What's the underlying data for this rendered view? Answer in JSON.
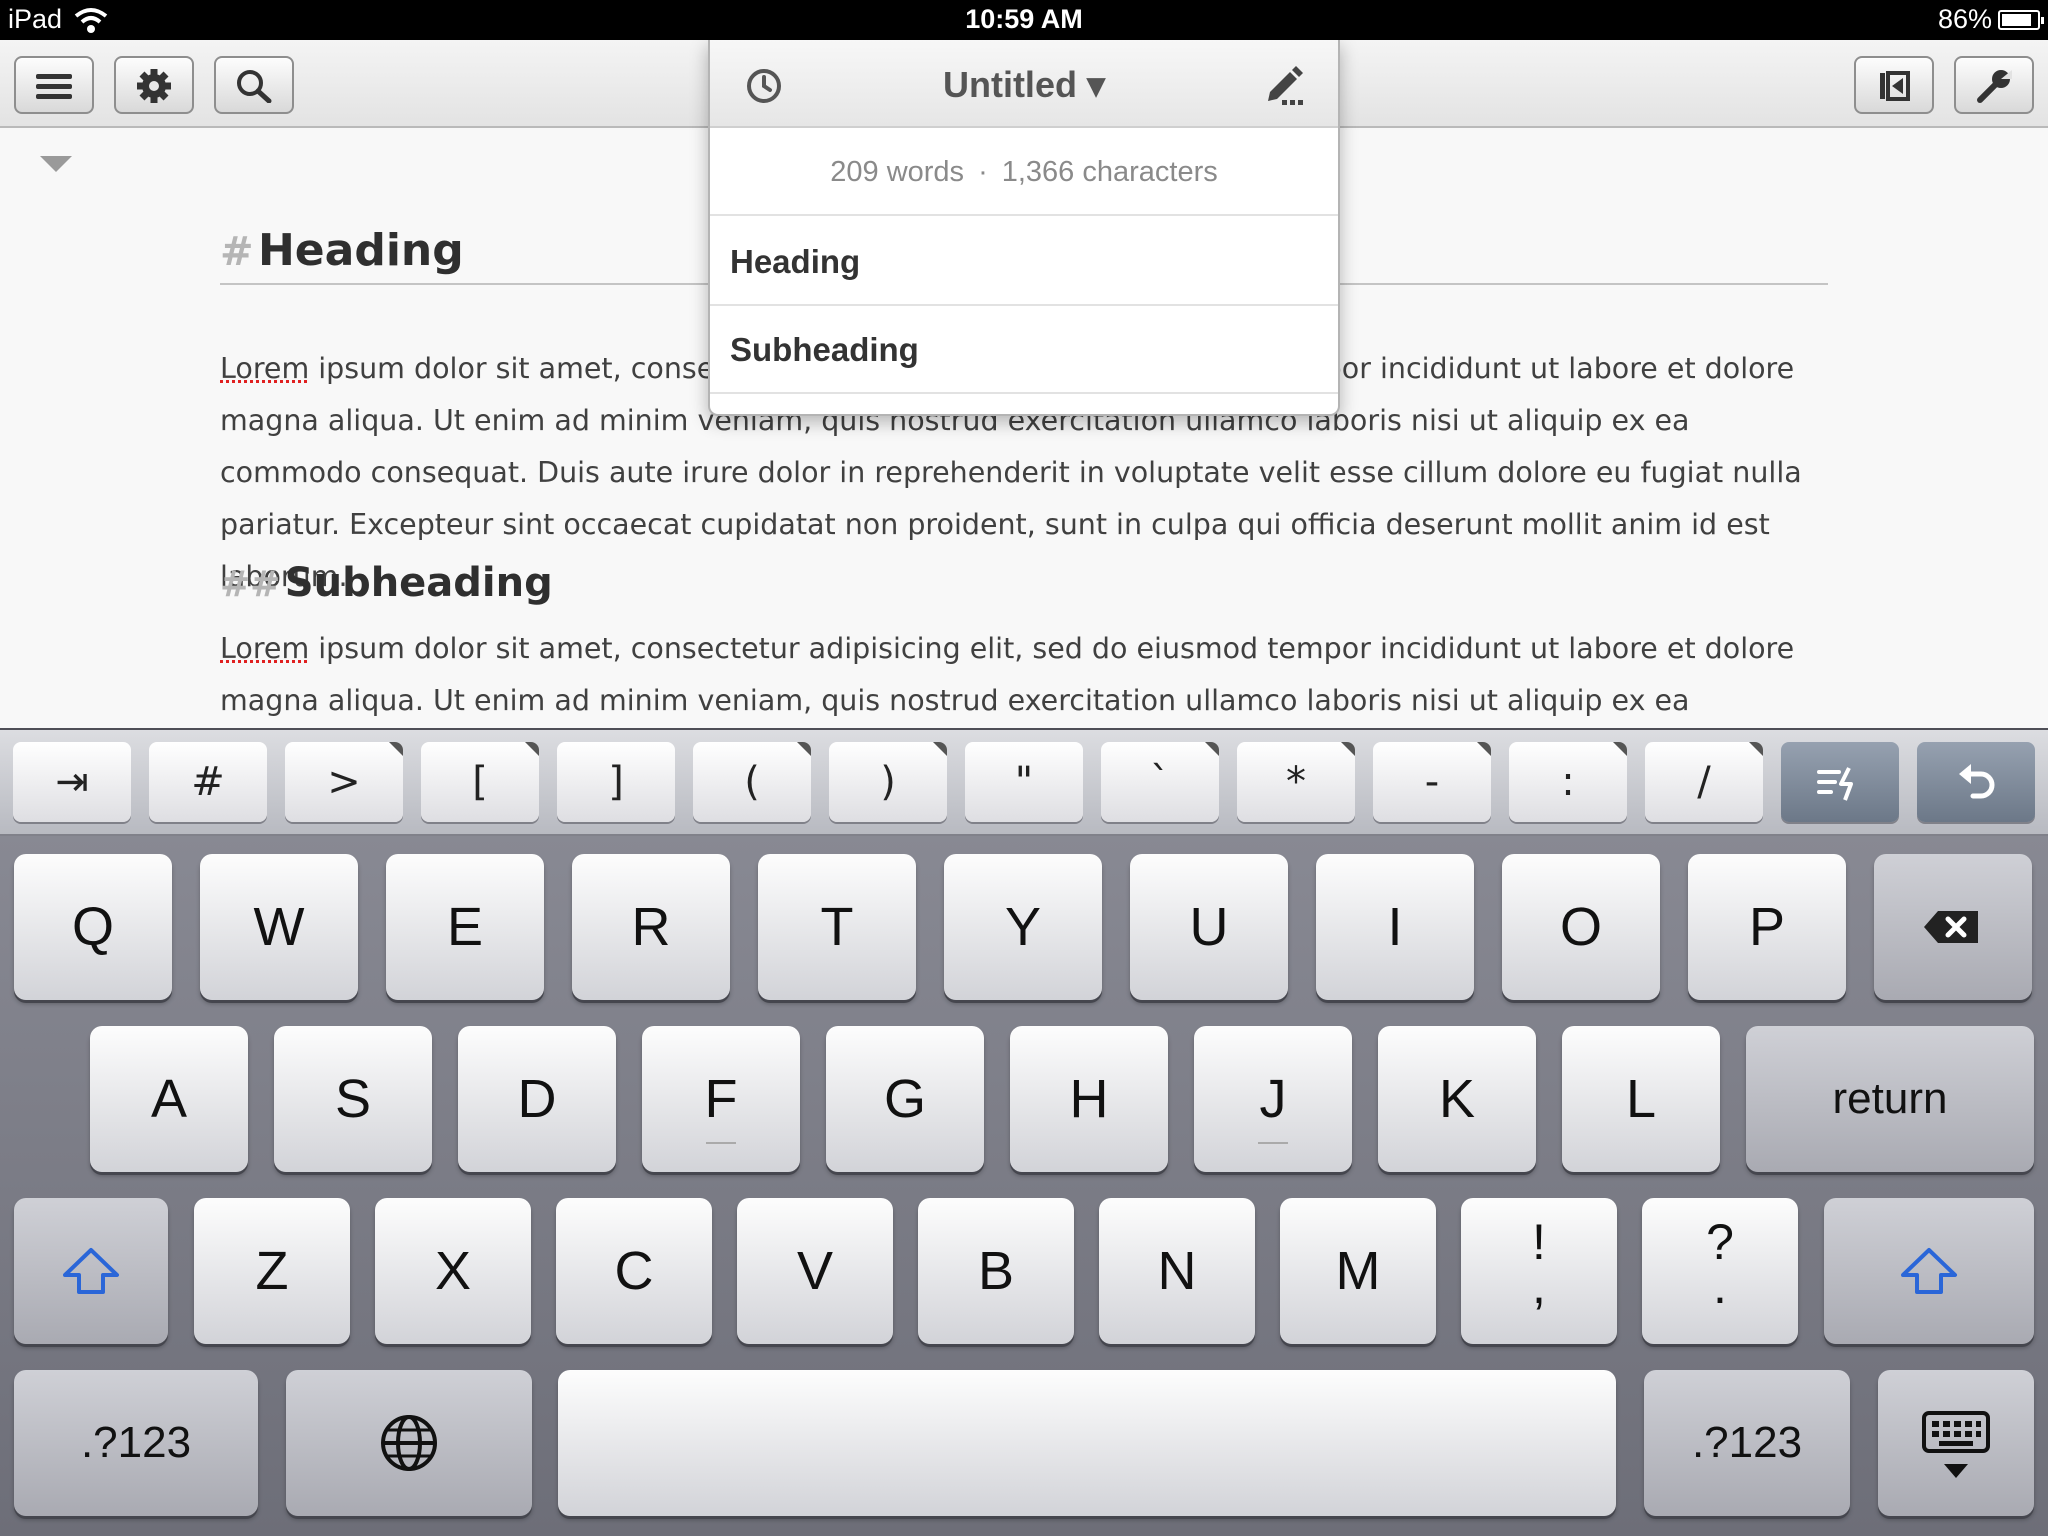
{
  "status_bar": {
    "device": "iPad",
    "time": "10:59 AM",
    "battery": "86%",
    "battery_level": 0.86
  },
  "toolbar": {
    "left_buttons": [
      "menu-icon",
      "gear-icon",
      "search-icon"
    ],
    "right_buttons": [
      "sidebar-toggle-icon",
      "wrench-icon"
    ]
  },
  "popover": {
    "title": "Untitled ▾",
    "words": "209 words",
    "separator": "·",
    "characters": "1,366 characters",
    "outline": [
      "Heading",
      "Subheading"
    ]
  },
  "document": {
    "h1_marker": "#",
    "h1_text": "Heading",
    "p1_first": "Lorem",
    "p1_rest": " ipsum dolor sit amet, consectetur adipisicing elit, sed do eiusmod tempor incididunt ut labore et dolore magna aliqua. Ut enim ad minim veniam, quis nostrud exercitation ullamco laboris nisi ut aliquip ex ea commodo consequat. Duis aute irure dolor in reprehenderit in voluptate velit esse cillum dolore eu fugiat nulla pariatur. Excepteur sint occaecat cupidatat non proident, sunt in culpa qui officia deserunt mollit anim id est laborum.",
    "h2_marker": "##",
    "h2_text": "Subheading",
    "p2_first": "Lorem",
    "p2_rest": " ipsum dolor sit amet, consectetur adipisicing elit, sed do eiusmod tempor incididunt ut labore et dolore magna aliqua. Ut enim ad minim veniam, quis nostrud exercitation ullamco laboris nisi ut aliquip ex ea commodo consequat."
  },
  "accessory_keys": [
    "⇥",
    "#",
    ">",
    "[",
    "]",
    "(",
    ")",
    "\"",
    "`",
    "*",
    "-",
    ":",
    "/"
  ],
  "keyboard": {
    "row1": [
      "Q",
      "W",
      "E",
      "R",
      "T",
      "Y",
      "U",
      "I",
      "O",
      "P"
    ],
    "row2": [
      "A",
      "S",
      "D",
      "F",
      "G",
      "H",
      "J",
      "K",
      "L"
    ],
    "row3": [
      "Z",
      "X",
      "C",
      "V",
      "B",
      "N",
      "M"
    ],
    "return_label": "return",
    "exclaim_top": "!",
    "exclaim_bottom": ",",
    "question_top": "?",
    "question_bottom": ".",
    "numbers_label": ".?123",
    "accent_color": "#2a66d8"
  }
}
